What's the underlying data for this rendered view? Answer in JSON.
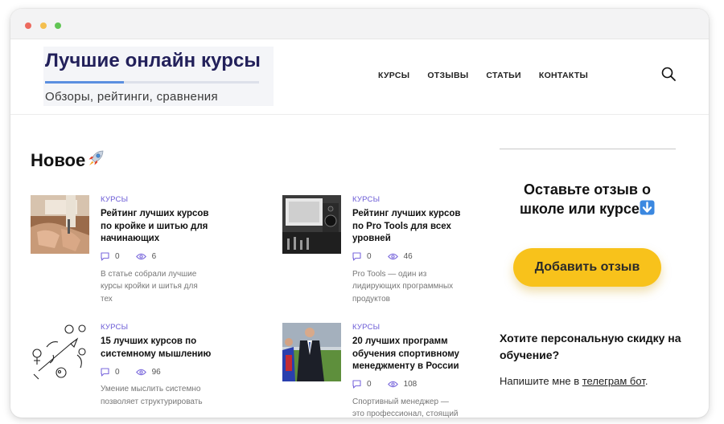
{
  "site": {
    "logo_title": "Лучшие онлайн курсы",
    "logo_subtitle": "Обзоры, рейтинги, сравнения",
    "logo_underline_fill_fraction": 0.37
  },
  "nav": {
    "items": [
      "КУРСЫ",
      "ОТЗЫВЫ",
      "СТАТЬИ",
      "КОНТАКТЫ"
    ],
    "search_icon": "search-icon"
  },
  "main": {
    "heading": "Новое",
    "heading_emoji": "rocket-icon",
    "cards": [
      {
        "category": "КУРСЫ",
        "title": "Рейтинг лучших курсов по кройке и шитью для начинающих",
        "comments": "0",
        "views": "6",
        "excerpt": "В статье собрали лучшие курсы кройки и шитья для тех",
        "thumbnail": "sewing-machine-photo"
      },
      {
        "category": "КУРСЫ",
        "title": "Рейтинг лучших курсов по Pro Tools для всех уровней",
        "comments": "0",
        "views": "46",
        "excerpt": "Pro Tools — один из лидирующих программных продуктов",
        "thumbnail": "studio-monitor-photo"
      },
      {
        "category": "КУРСЫ",
        "title": "15 лучших курсов по системному мышлению",
        "comments": "0",
        "views": "96",
        "excerpt": "Умение мыслить системно позволяет структурировать",
        "thumbnail": "systems-sketch-illustration"
      },
      {
        "category": "КУРСЫ",
        "title": "20 лучших программ обучения спортивному менеджменту в России",
        "comments": "0",
        "views": "108",
        "excerpt": "Спортивный менеджер — это профессионал, стоящий",
        "thumbnail": "sports-manager-photo"
      }
    ]
  },
  "sidebar": {
    "review_title": "Оставьте отзыв о школе или курсе",
    "review_emoji": "down-arrow-icon",
    "review_button": "Добавить отзыв",
    "discount_title": "Хотите персональную скидку на обучение?",
    "discount_text_before": "Напишите мне в ",
    "discount_link": "телеграм бот",
    "discount_text_after": "."
  },
  "colors": {
    "accent_yellow": "#f8c21b",
    "category_purple": "#6b5bd6",
    "logo_navy": "#22205a",
    "logo_underline_blue": "#5b8fe0"
  }
}
